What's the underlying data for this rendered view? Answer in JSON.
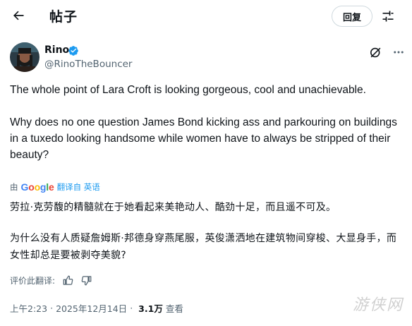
{
  "header": {
    "title": "帖子",
    "reply_label": "回复"
  },
  "author": {
    "name": "Rino",
    "handle": "@RinoTheBouncer"
  },
  "tweet": {
    "paragraph_1": "The whole point of Lara Croft is looking gorgeous, cool and unachievable.",
    "paragraph_2": "Why does no one question James Bond kicking ass and parkouring on buildings in a tuxedo looking handsome while women have to always be stripped of their beauty?"
  },
  "translation": {
    "by_label": "由",
    "provider": "Google",
    "link_label": "翻译自 英语",
    "paragraph_1": "劳拉·克劳馥的精髓就在于她看起来美艳动人、酷劲十足，而且遥不可及。",
    "paragraph_2": "为什么没有人质疑詹姆斯·邦德身穿燕尾服，英俊潇洒地在建筑物间穿梭、大显身手，而女性却总是要被剥夺美貌?",
    "rate_label": "评价此翻译:"
  },
  "meta": {
    "time": "上午2:23",
    "date": "2025年12月14日",
    "separator": "·",
    "views_count": "3.1万",
    "views_label": "查看"
  },
  "watermark": "游侠网",
  "colors": {
    "text": "#0f1419",
    "secondary": "#536471",
    "link": "#1d9bf0",
    "verified": "#1d9bf0"
  },
  "icons": [
    "back-arrow-icon",
    "adjust-icon",
    "verified-badge-icon",
    "grok-icon",
    "more-icon",
    "thumbs-up-icon",
    "thumbs-down-icon"
  ]
}
